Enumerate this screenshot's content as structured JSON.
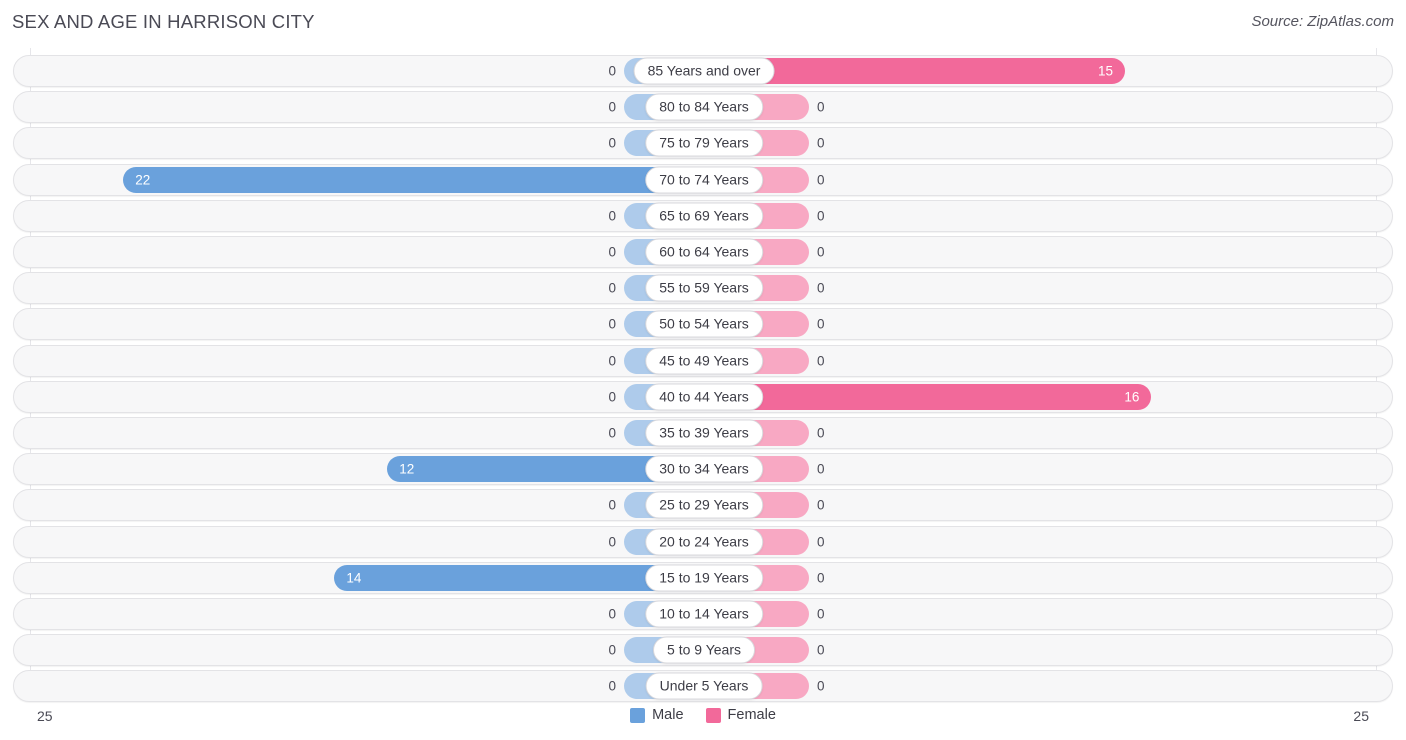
{
  "header": {
    "title": "SEX AND AGE IN HARRISON CITY",
    "source": "Source: ZipAtlas.com"
  },
  "legend": {
    "male_label": "Male",
    "female_label": "Female",
    "male_color": "#6aa1dc",
    "female_color": "#f2699a"
  },
  "axis": {
    "left_tick": "25",
    "right_tick": "25",
    "max": 25
  },
  "chart_data": {
    "type": "bar",
    "title": "SEX AND AGE IN HARRISON CITY",
    "xlabel": "",
    "ylabel": "",
    "orientation": "horizontal",
    "layout": "population-pyramid",
    "xlim": [
      -25,
      25
    ],
    "grid": true,
    "legend_position": "bottom-center",
    "categories": [
      "85 Years and over",
      "80 to 84 Years",
      "75 to 79 Years",
      "70 to 74 Years",
      "65 to 69 Years",
      "60 to 64 Years",
      "55 to 59 Years",
      "50 to 54 Years",
      "45 to 49 Years",
      "40 to 44 Years",
      "35 to 39 Years",
      "30 to 34 Years",
      "25 to 29 Years",
      "20 to 24 Years",
      "15 to 19 Years",
      "10 to 14 Years",
      "5 to 9 Years",
      "Under 5 Years"
    ],
    "series": [
      {
        "name": "Male",
        "color": "#6aa1dc",
        "values": [
          0,
          0,
          0,
          22,
          0,
          0,
          0,
          0,
          0,
          0,
          0,
          12,
          0,
          0,
          14,
          0,
          0,
          0
        ]
      },
      {
        "name": "Female",
        "color": "#f2699a",
        "values": [
          15,
          0,
          0,
          0,
          0,
          0,
          0,
          0,
          0,
          16,
          0,
          0,
          0,
          0,
          0,
          0,
          0,
          0
        ]
      }
    ]
  },
  "rows": [
    {
      "label": "85 Years and over",
      "male": "0",
      "female": "15"
    },
    {
      "label": "80 to 84 Years",
      "male": "0",
      "female": "0"
    },
    {
      "label": "75 to 79 Years",
      "male": "0",
      "female": "0"
    },
    {
      "label": "70 to 74 Years",
      "male": "22",
      "female": "0"
    },
    {
      "label": "65 to 69 Years",
      "male": "0",
      "female": "0"
    },
    {
      "label": "60 to 64 Years",
      "male": "0",
      "female": "0"
    },
    {
      "label": "55 to 59 Years",
      "male": "0",
      "female": "0"
    },
    {
      "label": "50 to 54 Years",
      "male": "0",
      "female": "0"
    },
    {
      "label": "45 to 49 Years",
      "male": "0",
      "female": "0"
    },
    {
      "label": "40 to 44 Years",
      "male": "0",
      "female": "16"
    },
    {
      "label": "35 to 39 Years",
      "male": "0",
      "female": "0"
    },
    {
      "label": "30 to 34 Years",
      "male": "12",
      "female": "0"
    },
    {
      "label": "25 to 29 Years",
      "male": "0",
      "female": "0"
    },
    {
      "label": "20 to 24 Years",
      "male": "0",
      "female": "0"
    },
    {
      "label": "15 to 19 Years",
      "male": "14",
      "female": "0"
    },
    {
      "label": "10 to 14 Years",
      "male": "0",
      "female": "0"
    },
    {
      "label": "5 to 9 Years",
      "male": "0",
      "female": "0"
    },
    {
      "label": "Under 5 Years",
      "male": "0",
      "female": "0"
    }
  ]
}
